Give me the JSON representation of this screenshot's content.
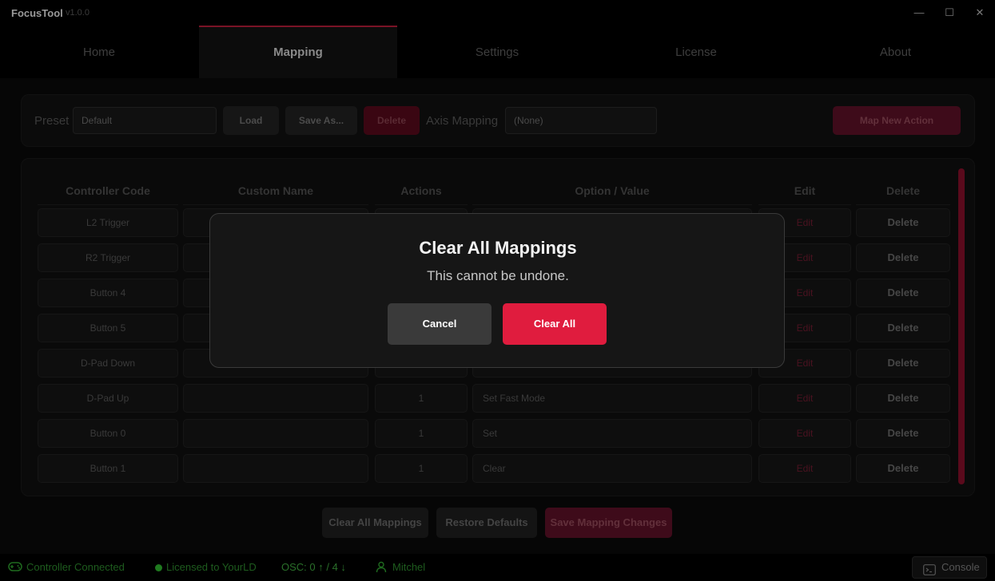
{
  "titlebar": {
    "app_name": "FocusTool",
    "version": "v1.0.0",
    "minimize": "—",
    "maximize": "☐",
    "close": "✕"
  },
  "tabs": [
    {
      "label": "Home"
    },
    {
      "label": "Mapping",
      "active": true
    },
    {
      "label": "Settings"
    },
    {
      "label": "License"
    },
    {
      "label": "About"
    }
  ],
  "preset": {
    "label": "Preset",
    "value": "Default",
    "load": "Load",
    "save_as": "Save As...",
    "delete": "Delete",
    "axis_label": "Axis Mapping",
    "axis_value": "(None)",
    "map_new": "Map New Action"
  },
  "table": {
    "headers": [
      "Controller Code",
      "Custom Name",
      "Actions",
      "Option / Value",
      "Edit",
      "Delete"
    ],
    "rows": [
      {
        "code": "L2 Trigger",
        "name": "",
        "actions": "",
        "option": "",
        "edit": "Edit",
        "delete": "Delete"
      },
      {
        "code": "R2 Trigger",
        "name": "",
        "actions": "",
        "option": "",
        "edit": "Edit",
        "delete": "Delete"
      },
      {
        "code": "Button 4",
        "name": "",
        "actions": "",
        "option": "",
        "edit": "Edit",
        "delete": "Delete"
      },
      {
        "code": "Button 5",
        "name": "",
        "actions": "",
        "option": "",
        "edit": "Edit",
        "delete": "Delete"
      },
      {
        "code": "D-Pad Down",
        "name": "",
        "actions": "",
        "option": "",
        "edit": "Edit",
        "delete": "Delete"
      },
      {
        "code": "D-Pad Up",
        "name": "",
        "actions": "1",
        "option": "Set Fast Mode",
        "edit": "Edit",
        "delete": "Delete"
      },
      {
        "code": "Button 0",
        "name": "",
        "actions": "1",
        "option": "Set",
        "edit": "Edit",
        "delete": "Delete"
      },
      {
        "code": "Button 1",
        "name": "",
        "actions": "1",
        "option": "Clear",
        "edit": "Edit",
        "delete": "Delete"
      }
    ]
  },
  "bottom": {
    "clear_all": "Clear All Mappings",
    "restore": "Restore Defaults",
    "save": "Save Mapping Changes"
  },
  "status": {
    "controller": "Controller Connected",
    "license": "Licensed to YourLD",
    "osc": "OSC:  0 ↑ / 4 ↓",
    "user": "Mitchel",
    "console": "Console"
  },
  "modal": {
    "title": "Clear All Mappings",
    "message": "This cannot be undone.",
    "cancel": "Cancel",
    "confirm": "Clear All"
  },
  "colors": {
    "accent": "#e01c3e",
    "status_green": "#1f7a1f"
  }
}
